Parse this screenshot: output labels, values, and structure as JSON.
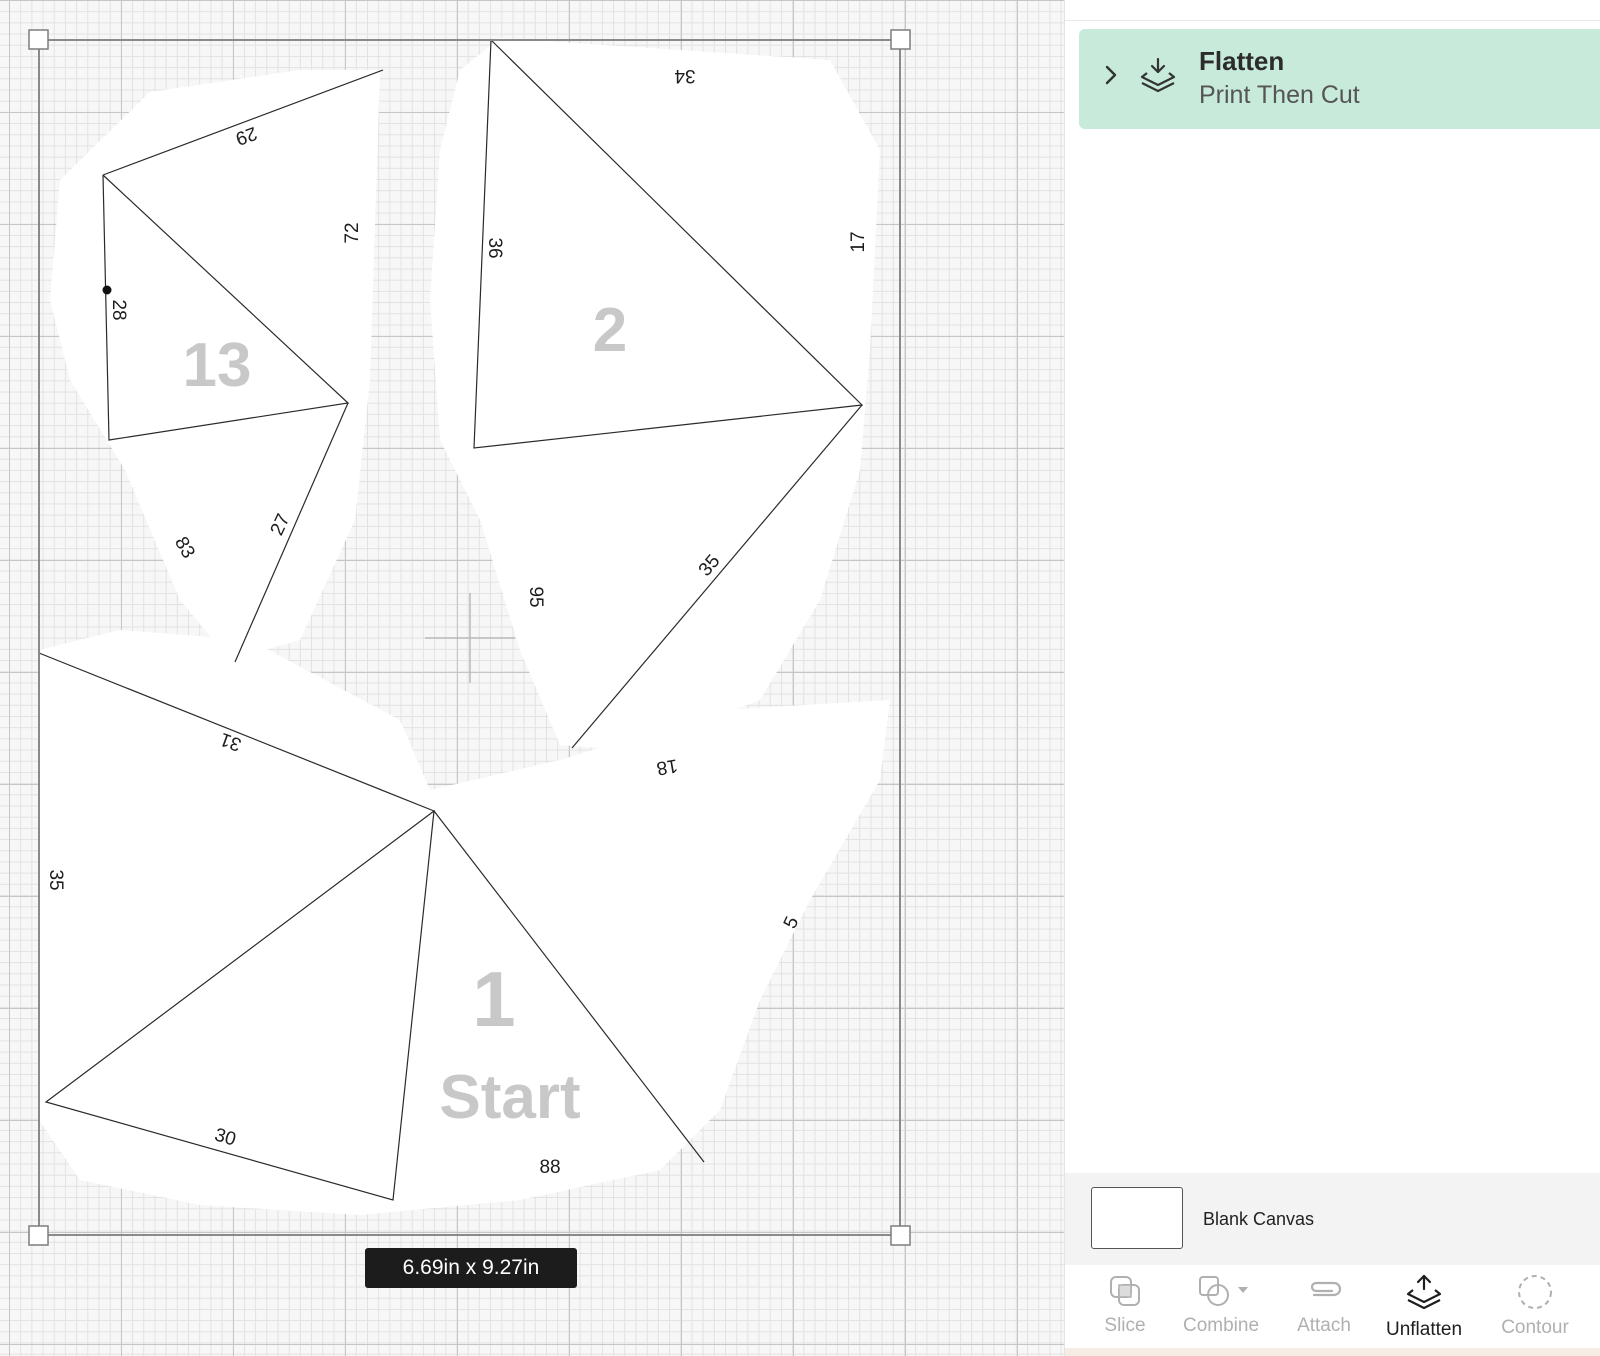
{
  "canvas": {
    "edge_numbers": [
      "29",
      "72",
      "28",
      "83",
      "27",
      "34",
      "36",
      "17",
      "95",
      "35",
      "31",
      "18",
      "35",
      "5",
      "30",
      "88"
    ],
    "piece_labels": [
      "13",
      "2",
      "1",
      "Start"
    ],
    "size_readout": {
      "width": "6.69",
      "height": "9.27",
      "unit": "in"
    }
  },
  "layers_panel": {
    "layer": {
      "title": "Flatten",
      "subtitle": "Print Then Cut",
      "icon": "flatten-icon",
      "expand_icon": "chevron-right-icon"
    },
    "canvas_row": {
      "label": "Blank Canvas"
    }
  },
  "toolbar": {
    "tools": [
      {
        "label": "Slice",
        "icon": "slice-icon",
        "enabled": false
      },
      {
        "label": "Combine",
        "icon": "combine-icon",
        "enabled": false
      },
      {
        "label": "Attach",
        "icon": "attach-icon",
        "enabled": false
      },
      {
        "label": "Unflatten",
        "icon": "unflatten-icon",
        "enabled": true
      },
      {
        "label": "Contour",
        "icon": "contour-icon",
        "enabled": false
      }
    ]
  },
  "colors": {
    "layer_highlight": "#c7eadb",
    "size_badge_bg": "#1c1c1c",
    "disabled_tool": "#b0b0b0"
  }
}
